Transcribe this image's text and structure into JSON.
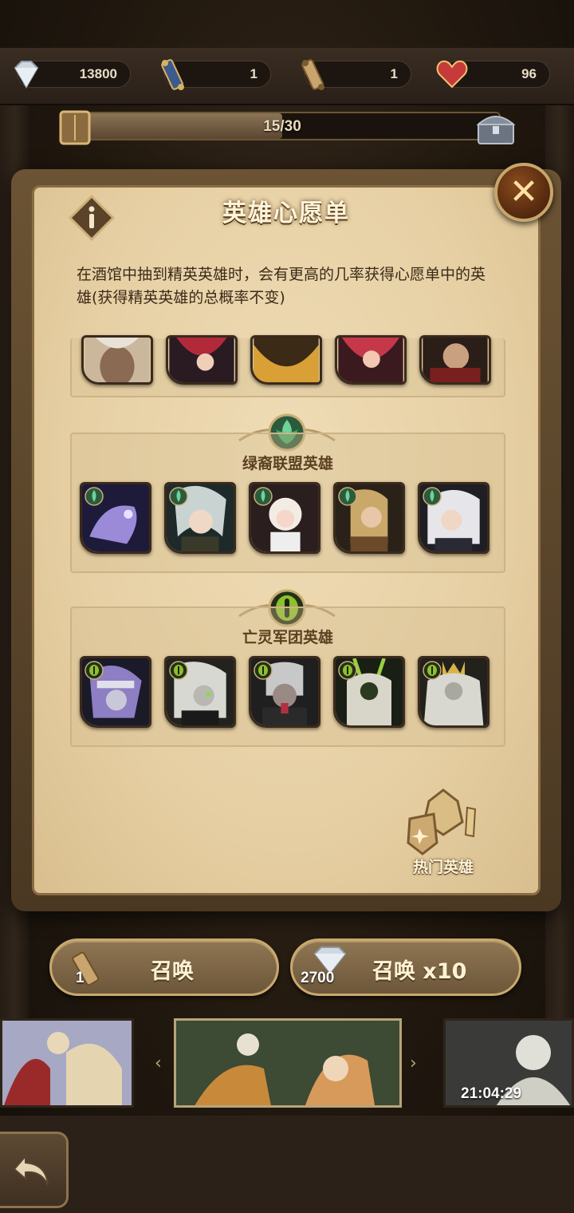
{
  "resources": {
    "diamonds": "13800",
    "scrolls": "1",
    "faction_scrolls": "1",
    "hearts": "96"
  },
  "progress": {
    "text": "15/30",
    "fraction": 0.5
  },
  "dialog": {
    "title": "英雄心愿单",
    "description": "在酒馆中抽到精英英雄时，会有更高的几率获得心愿单中的英雄(获得精英英雄的总概率不变)",
    "groups": [
      {
        "label": "绿裔联盟英雄",
        "emblem_color": "#3fa56a"
      },
      {
        "label": "亡灵军团英雄",
        "emblem_color": "#8dbf2e"
      }
    ],
    "hot_heroes_label": "热门英雄"
  },
  "summon": {
    "single_label": "召唤",
    "single_cost": "1",
    "multi_label": "召唤 x10",
    "multi_cost": "2700"
  },
  "banner": {
    "timer": "21:04:29"
  },
  "colors": {
    "parchment": "#e6cfa3",
    "gold_frame": "#c9a96f",
    "wilder_green": "#3fa56a",
    "graveborn_green": "#8dbf2e"
  }
}
